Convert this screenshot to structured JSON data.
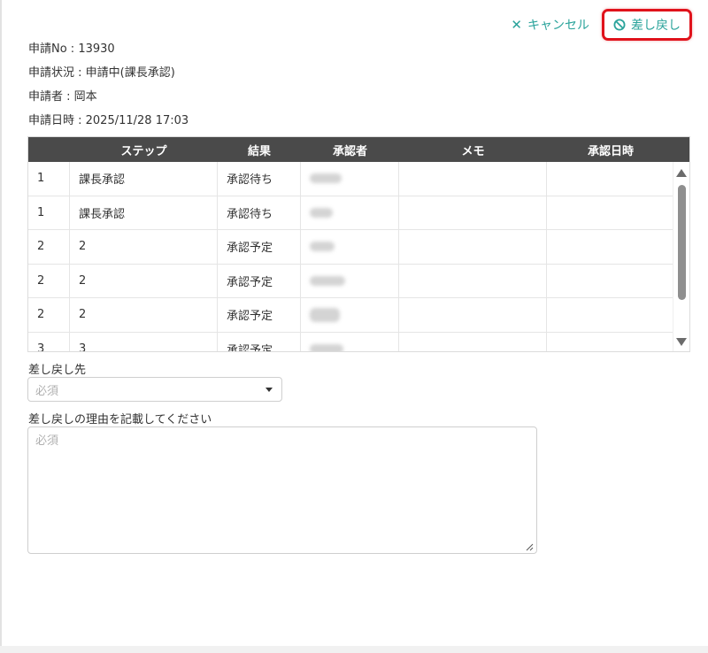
{
  "header": {
    "cancel_label": "キャンセル",
    "return_label": "差し戻し",
    "accent_color": "#2aa39b",
    "highlight_color": "#e0121b"
  },
  "info": {
    "request_no": "申請No : 13930",
    "status": "申請状況 : 申請中(課長承認)",
    "applicant": "申請者 : 岡本",
    "date": "申請日時 : 2025/11/28 17:03"
  },
  "table": {
    "columns": [
      "",
      "ステップ",
      "結果",
      "承認者",
      "メモ",
      "承認日時"
    ],
    "rows": [
      {
        "no": "1",
        "step": "課長承認",
        "result": "承認待ち",
        "memo": "",
        "date": ""
      },
      {
        "no": "1",
        "step": "課長承認",
        "result": "承認待ち",
        "memo": "",
        "date": ""
      },
      {
        "no": "2",
        "step": "2",
        "result": "承認予定",
        "memo": "",
        "date": ""
      },
      {
        "no": "2",
        "step": "2",
        "result": "承認予定",
        "memo": "",
        "date": ""
      },
      {
        "no": "2",
        "step": "2",
        "result": "承認予定",
        "memo": "",
        "date": ""
      },
      {
        "no": "3",
        "step": "3",
        "result": "承認予定",
        "memo": "",
        "date": ""
      }
    ]
  },
  "form": {
    "return_to_label": "差し戻し先",
    "return_to_placeholder": "必須",
    "reason_label": "差し戻しの理由を記載してください",
    "reason_placeholder": "必須"
  }
}
